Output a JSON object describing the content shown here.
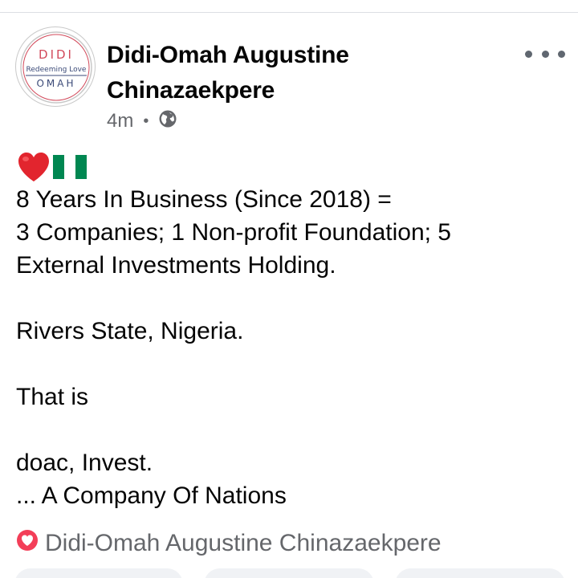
{
  "post": {
    "author": "Didi-Omah Augustine Chinazaekpere",
    "time": "4m",
    "separator": "•",
    "privacy_icon": "globe-icon",
    "avatar": {
      "logo_top": "DIDI",
      "logo_middle": "Redeeming Love",
      "logo_bottom": "OMAH",
      "colors": {
        "ring": "#c8c8c8",
        "red": "#d24a5b",
        "navy": "#3b4a78"
      }
    },
    "emojis": [
      "heart-emoji",
      "nigeria-flag-emoji"
    ],
    "body_lines": [
      "8 Years In Business (Since 2018) =",
      "3 Companies; 1 Non-profit Foundation; 5",
      "External Investments Holding.",
      "",
      "Rivers State, Nigeria.",
      "",
      "That is",
      "",
      "doac, Invest.",
      "... A Company Of Nations"
    ]
  },
  "reactions": {
    "icon": "love-reaction-icon",
    "by": "Didi-Omah Augustine Chinazaekpere",
    "colors": {
      "love": "#f33e58"
    }
  },
  "ui_colors": {
    "text": "#050505",
    "secondary": "#65676b",
    "divider": "#dcdfe3"
  }
}
